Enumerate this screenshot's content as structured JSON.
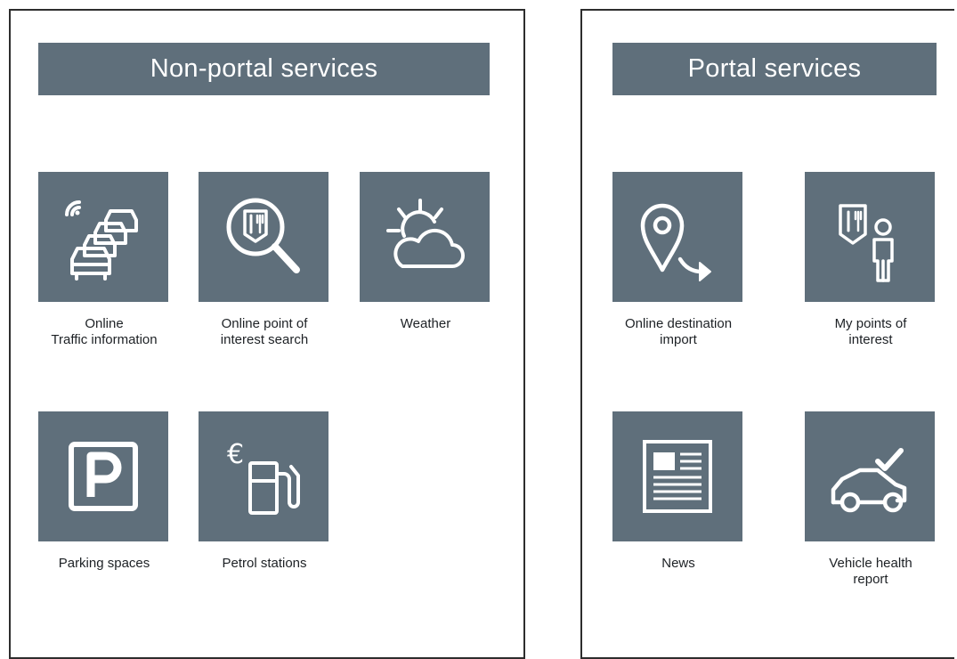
{
  "left_panel": {
    "title": "Non-portal services",
    "tiles": [
      {
        "label": "Online\nTraffic information",
        "icon": "traffic-icon"
      },
      {
        "label": "Online point of\ninterest search",
        "icon": "poi-search-icon"
      },
      {
        "label": "Weather",
        "icon": "weather-icon"
      },
      {
        "label": "Parking spaces",
        "icon": "parking-icon"
      },
      {
        "label": "Petrol stations",
        "icon": "petrol-station-icon"
      }
    ]
  },
  "right_panel": {
    "title": "Portal services",
    "tiles": [
      {
        "label": "Online destination\nimport",
        "icon": "destination-import-icon"
      },
      {
        "label": "My points of\ninterest",
        "icon": "my-poi-icon"
      },
      {
        "label": "News",
        "icon": "news-icon"
      },
      {
        "label": "Vehicle health\nreport",
        "icon": "vehicle-health-icon"
      }
    ]
  },
  "colors": {
    "tile": "#5f6f7b",
    "border": "#2d2d2d",
    "icon": "#ffffff"
  }
}
